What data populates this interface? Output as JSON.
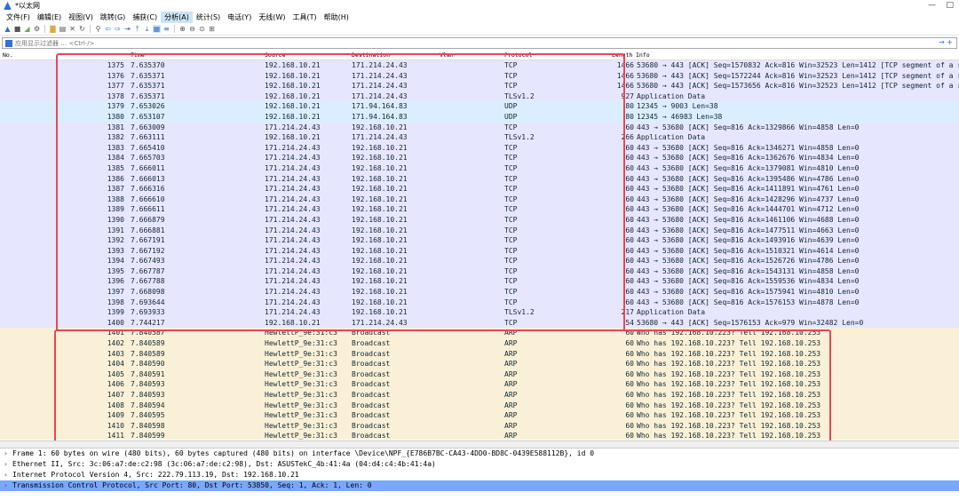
{
  "window": {
    "title": "*以太网",
    "minimize": "—",
    "maximize": "□"
  },
  "menu": [
    "文件(F)",
    "编辑(E)",
    "视图(V)",
    "跳转(G)",
    "捕获(C)",
    "分析(A)",
    "统计(S)",
    "电话(Y)",
    "无线(W)",
    "工具(T)",
    "帮助(H)"
  ],
  "filter": {
    "placeholder": "应用显示过滤器 … <Ctrl-/>",
    "value": ""
  },
  "columns": {
    "no": "No.",
    "time": "Time",
    "source": "Source",
    "destination": "Destination",
    "vlan": "Vlan",
    "protocol": "Protocol",
    "length": "Length",
    "info": "Info"
  },
  "packets": [
    {
      "no": "1375",
      "time": "7.635370",
      "src": "192.168.10.21",
      "dst": "171.214.24.43",
      "proto": "TCP",
      "len": "1466",
      "info": "53680 → 443 [ACK] Seq=1570832 Ack=816 Win=32523 Len=1412 [TCP segment of a rea"
    },
    {
      "no": "1376",
      "time": "7.635371",
      "src": "192.168.10.21",
      "dst": "171.214.24.43",
      "proto": "TCP",
      "len": "1466",
      "info": "53680 → 443 [ACK] Seq=1572244 Ack=816 Win=32523 Len=1412 [TCP segment of a rea"
    },
    {
      "no": "1377",
      "time": "7.635371",
      "src": "192.168.10.21",
      "dst": "171.214.24.43",
      "proto": "TCP",
      "len": "1466",
      "info": "53680 → 443 [ACK] Seq=1573656 Ack=816 Win=32523 Len=1412 [TCP segment of a rea"
    },
    {
      "no": "1378",
      "time": "7.635371",
      "src": "192.168.10.21",
      "dst": "171.214.24.43",
      "proto": "TLSv1.2",
      "len": "927",
      "info": "Application Data"
    },
    {
      "no": "1379",
      "time": "7.653026",
      "src": "192.168.10.21",
      "dst": "171.94.164.83",
      "proto": "UDP",
      "len": "80",
      "info": "12345 → 9003 Len=38"
    },
    {
      "no": "1380",
      "time": "7.653107",
      "src": "192.168.10.21",
      "dst": "171.94.164.83",
      "proto": "UDP",
      "len": "80",
      "info": "12345 → 46983 Len=38"
    },
    {
      "no": "1381",
      "time": "7.663009",
      "src": "171.214.24.43",
      "dst": "192.168.10.21",
      "proto": "TCP",
      "len": "60",
      "info": "443 → 53680 [ACK] Seq=816 Ack=1329866 Win=4858 Len=0"
    },
    {
      "no": "1382",
      "time": "7.663111",
      "src": "192.168.10.21",
      "dst": "171.214.24.43",
      "proto": "TLSv1.2",
      "len": "266",
      "info": "Application Data"
    },
    {
      "no": "1383",
      "time": "7.665410",
      "src": "171.214.24.43",
      "dst": "192.168.10.21",
      "proto": "TCP",
      "len": "60",
      "info": "443 → 53680 [ACK] Seq=816 Ack=1346271 Win=4858 Len=0"
    },
    {
      "no": "1384",
      "time": "7.665703",
      "src": "171.214.24.43",
      "dst": "192.168.10.21",
      "proto": "TCP",
      "len": "60",
      "info": "443 → 53680 [ACK] Seq=816 Ack=1362676 Win=4834 Len=0"
    },
    {
      "no": "1385",
      "time": "7.666011",
      "src": "171.214.24.43",
      "dst": "192.168.10.21",
      "proto": "TCP",
      "len": "60",
      "info": "443 → 53680 [ACK] Seq=816 Ack=1379081 Win=4810 Len=0"
    },
    {
      "no": "1386",
      "time": "7.666013",
      "src": "171.214.24.43",
      "dst": "192.168.10.21",
      "proto": "TCP",
      "len": "60",
      "info": "443 → 53680 [ACK] Seq=816 Ack=1395486 Win=4786 Len=0"
    },
    {
      "no": "1387",
      "time": "7.666316",
      "src": "171.214.24.43",
      "dst": "192.168.10.21",
      "proto": "TCP",
      "len": "60",
      "info": "443 → 53680 [ACK] Seq=816 Ack=1411891 Win=4761 Len=0"
    },
    {
      "no": "1388",
      "time": "7.666610",
      "src": "171.214.24.43",
      "dst": "192.168.10.21",
      "proto": "TCP",
      "len": "60",
      "info": "443 → 53680 [ACK] Seq=816 Ack=1428296 Win=4737 Len=0"
    },
    {
      "no": "1389",
      "time": "7.666611",
      "src": "171.214.24.43",
      "dst": "192.168.10.21",
      "proto": "TCP",
      "len": "60",
      "info": "443 → 53680 [ACK] Seq=816 Ack=1444701 Win=4712 Len=0"
    },
    {
      "no": "1390",
      "time": "7.666879",
      "src": "171.214.24.43",
      "dst": "192.168.10.21",
      "proto": "TCP",
      "len": "60",
      "info": "443 → 53680 [ACK] Seq=816 Ack=1461106 Win=4688 Len=0"
    },
    {
      "no": "1391",
      "time": "7.666881",
      "src": "171.214.24.43",
      "dst": "192.168.10.21",
      "proto": "TCP",
      "len": "60",
      "info": "443 → 53680 [ACK] Seq=816 Ack=1477511 Win=4663 Len=0"
    },
    {
      "no": "1392",
      "time": "7.667191",
      "src": "171.214.24.43",
      "dst": "192.168.10.21",
      "proto": "TCP",
      "len": "60",
      "info": "443 → 53680 [ACK] Seq=816 Ack=1493916 Win=4639 Len=0"
    },
    {
      "no": "1393",
      "time": "7.667192",
      "src": "171.214.24.43",
      "dst": "192.168.10.21",
      "proto": "TCP",
      "len": "60",
      "info": "443 → 53680 [ACK] Seq=816 Ack=1510321 Win=4614 Len=0"
    },
    {
      "no": "1394",
      "time": "7.667493",
      "src": "171.214.24.43",
      "dst": "192.168.10.21",
      "proto": "TCP",
      "len": "60",
      "info": "443 → 53680 [ACK] Seq=816 Ack=1526726 Win=4786 Len=0"
    },
    {
      "no": "1395",
      "time": "7.667787",
      "src": "171.214.24.43",
      "dst": "192.168.10.21",
      "proto": "TCP",
      "len": "60",
      "info": "443 → 53680 [ACK] Seq=816 Ack=1543131 Win=4858 Len=0"
    },
    {
      "no": "1396",
      "time": "7.667788",
      "src": "171.214.24.43",
      "dst": "192.168.10.21",
      "proto": "TCP",
      "len": "60",
      "info": "443 → 53680 [ACK] Seq=816 Ack=1559536 Win=4834 Len=0"
    },
    {
      "no": "1397",
      "time": "7.668098",
      "src": "171.214.24.43",
      "dst": "192.168.10.21",
      "proto": "TCP",
      "len": "60",
      "info": "443 → 53680 [ACK] Seq=816 Ack=1575941 Win=4810 Len=0"
    },
    {
      "no": "1398",
      "time": "7.693644",
      "src": "171.214.24.43",
      "dst": "192.168.10.21",
      "proto": "TCP",
      "len": "60",
      "info": "443 → 53680 [ACK] Seq=816 Ack=1576153 Win=4878 Len=0"
    },
    {
      "no": "1399",
      "time": "7.693933",
      "src": "171.214.24.43",
      "dst": "192.168.10.21",
      "proto": "TLSv1.2",
      "len": "217",
      "info": "Application Data"
    },
    {
      "no": "1400",
      "time": "7.744217",
      "src": "192.168.10.21",
      "dst": "171.214.24.43",
      "proto": "TCP",
      "len": "54",
      "info": "53680 → 443 [ACK] Seq=1576153 Ack=979 Win=32482 Len=0"
    },
    {
      "no": "1401",
      "time": "7.840587",
      "src": "HewlettP_9e:31:c3",
      "dst": "Broadcast",
      "proto": "ARP",
      "len": "60",
      "info": "Who has 192.168.10.223? Tell 192.168.10.253"
    },
    {
      "no": "1402",
      "time": "7.840589",
      "src": "HewlettP_9e:31:c3",
      "dst": "Broadcast",
      "proto": "ARP",
      "len": "60",
      "info": "Who has 192.168.10.223? Tell 192.168.10.253"
    },
    {
      "no": "1403",
      "time": "7.840589",
      "src": "HewlettP_9e:31:c3",
      "dst": "Broadcast",
      "proto": "ARP",
      "len": "60",
      "info": "Who has 192.168.10.223? Tell 192.168.10.253"
    },
    {
      "no": "1404",
      "time": "7.840590",
      "src": "HewlettP_9e:31:c3",
      "dst": "Broadcast",
      "proto": "ARP",
      "len": "60",
      "info": "Who has 192.168.10.223? Tell 192.168.10.253"
    },
    {
      "no": "1405",
      "time": "7.840591",
      "src": "HewlettP_9e:31:c3",
      "dst": "Broadcast",
      "proto": "ARP",
      "len": "60",
      "info": "Who has 192.168.10.223? Tell 192.168.10.253"
    },
    {
      "no": "1406",
      "time": "7.840593",
      "src": "HewlettP_9e:31:c3",
      "dst": "Broadcast",
      "proto": "ARP",
      "len": "60",
      "info": "Who has 192.168.10.223? Tell 192.168.10.253"
    },
    {
      "no": "1407",
      "time": "7.840593",
      "src": "HewlettP_9e:31:c3",
      "dst": "Broadcast",
      "proto": "ARP",
      "len": "60",
      "info": "Who has 192.168.10.223? Tell 192.168.10.253"
    },
    {
      "no": "1408",
      "time": "7.840594",
      "src": "HewlettP_9e:31:c3",
      "dst": "Broadcast",
      "proto": "ARP",
      "len": "60",
      "info": "Who has 192.168.10.223? Tell 192.168.10.253"
    },
    {
      "no": "1409",
      "time": "7.840595",
      "src": "HewlettP_9e:31:c3",
      "dst": "Broadcast",
      "proto": "ARP",
      "len": "60",
      "info": "Who has 192.168.10.223? Tell 192.168.10.253"
    },
    {
      "no": "1410",
      "time": "7.840598",
      "src": "HewlettP_9e:31:c3",
      "dst": "Broadcast",
      "proto": "ARP",
      "len": "60",
      "info": "Who has 192.168.10.223? Tell 192.168.10.253"
    },
    {
      "no": "1411",
      "time": "7.840599",
      "src": "HewlettP_9e:31:c3",
      "dst": "Broadcast",
      "proto": "ARP",
      "len": "60",
      "info": "Who has 192.168.10.223? Tell 192.168.10.253"
    }
  ],
  "details": [
    {
      "text": "Frame 1: 60 bytes on wire (480 bits), 60 bytes captured (480 bits) on interface \\Device\\NPF_{E786B7BC-CA43-4DD0-BD8C-0439E588112B}, id 0",
      "selected": false
    },
    {
      "text": "Ethernet II, Src: 3c:06:a7:de:c2:98 (3c:06:a7:de:c2:98), Dst: ASUSTekC_4b:41:4a (04:d4:c4:4b:41:4a)",
      "selected": false
    },
    {
      "text": "Internet Protocol Version 4, Src: 222.79.113.19, Dst: 192.168.10.21",
      "selected": false
    },
    {
      "text": "Transmission Control Protocol, Src Port: 80, Dst Port: 53850, Seq: 1, Ack: 1, Len: 0",
      "selected": true
    }
  ],
  "colors": {
    "tcp": "#e7e6ff",
    "udp": "#daeeff",
    "arp": "#faf0d7",
    "highlight": "#e5475e",
    "selected": "#76a9ff"
  }
}
